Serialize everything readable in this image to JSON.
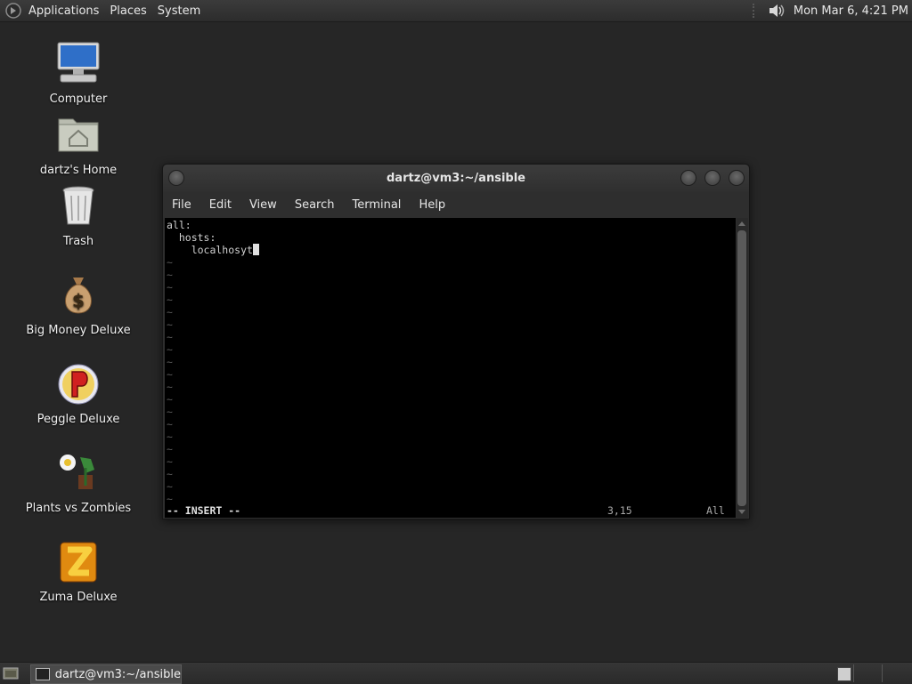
{
  "top_panel": {
    "menus": [
      "Applications",
      "Places",
      "System"
    ],
    "clock": "Mon Mar  6,  4:21 PM",
    "icons": [
      "app-menu-logo-icon",
      "volume-icon"
    ]
  },
  "desktop_icons": [
    {
      "label": "Computer",
      "icon": "computer-icon"
    },
    {
      "label": "dartz's Home",
      "icon": "home-folder-icon"
    },
    {
      "label": "Trash",
      "icon": "trash-icon"
    },
    {
      "label": "Big Money Deluxe",
      "icon": "money-bag-icon"
    },
    {
      "label": "Peggle Deluxe",
      "icon": "peggle-icon"
    },
    {
      "label": "Plants vs Zombies",
      "icon": "plants-vs-zombies-icon"
    },
    {
      "label": "Zuma Deluxe",
      "icon": "zuma-icon"
    }
  ],
  "terminal": {
    "title": "dartz@vm3:~/ansible",
    "menu": [
      "File",
      "Edit",
      "View",
      "Search",
      "Terminal",
      "Help"
    ],
    "lines": [
      "all:",
      "  hosts:",
      "    localhosyt"
    ],
    "tilde": "~",
    "status_mode": "-- INSERT --",
    "status_position": "3,15",
    "status_scroll": "All"
  },
  "taskbar": {
    "task_label": "dartz@vm3:~/ansible"
  }
}
